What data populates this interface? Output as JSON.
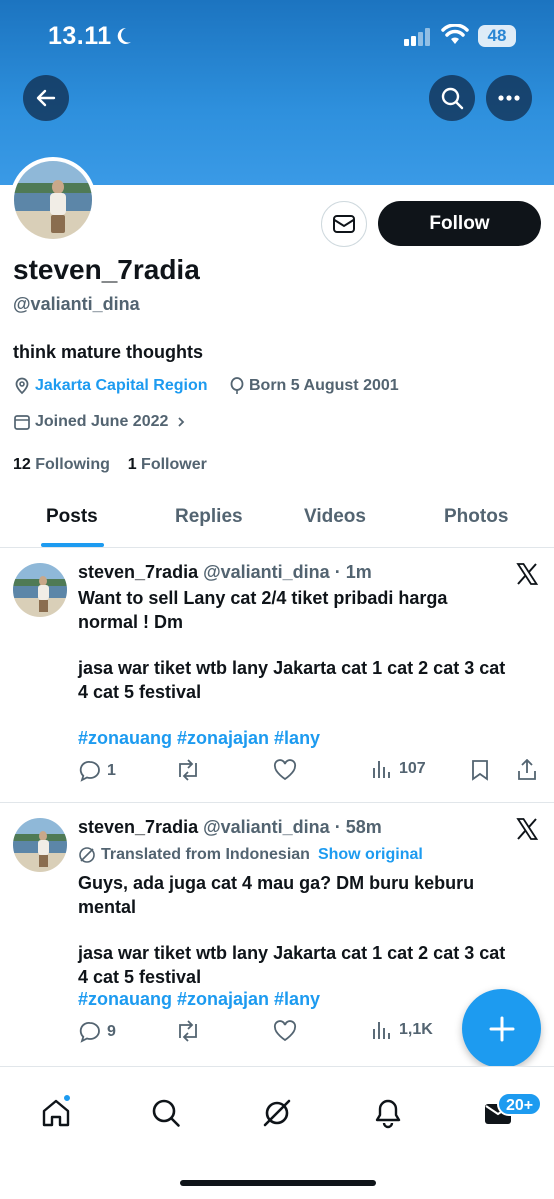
{
  "status_bar": {
    "time": "13.11",
    "battery": "48"
  },
  "profile": {
    "display_name": "steven_7radia",
    "handle": "@valianti_dina",
    "bio": "think mature thoughts",
    "location": "Jakarta Capital Region",
    "born": "Born 5 August 2001",
    "joined": "Joined June 2022",
    "following_count": "12",
    "following_label": "Following",
    "followers_count": "1",
    "followers_label": "Follower",
    "follow_button": "Follow"
  },
  "tabs": [
    {
      "label": "Posts",
      "active": true
    },
    {
      "label": "Replies",
      "active": false
    },
    {
      "label": "Videos",
      "active": false
    },
    {
      "label": "Photos",
      "active": false
    }
  ],
  "posts": [
    {
      "name": "steven_7radia",
      "handle": "@valianti_dina",
      "time": "· 1m",
      "line1": "Want to sell Lany cat 2/4 tiket pribadi harga",
      "line2": "normal ! Dm",
      "line3": "jasa war tiket wtb lany Jakarta cat 1 cat 2 cat 3 cat",
      "line4": "4 cat 5 festival",
      "hashtags": "#zonauang #zonajajan #lany",
      "replies": "1",
      "views": "107"
    },
    {
      "name": "steven_7radia",
      "handle": "@valianti_dina",
      "time": "· 58m",
      "translated": "Translated from Indonesian",
      "show_original": "Show original",
      "line1": "Guys, ada juga cat 4 mau ga? DM buru keburu",
      "line2": "mental",
      "line3": "jasa war tiket wtb lany Jakarta cat 1 cat 2 cat 3 cat",
      "line4": "4 cat 5 festival",
      "hashtags": "#zonauang #zonajajan #lany",
      "replies": "9",
      "views": "1,1K"
    }
  ],
  "nav": {
    "messages_badge": "20+"
  },
  "colors": {
    "accent": "#1d9bf0",
    "banner": "#2e90dd",
    "text": "#0f1419",
    "muted": "#536471"
  }
}
